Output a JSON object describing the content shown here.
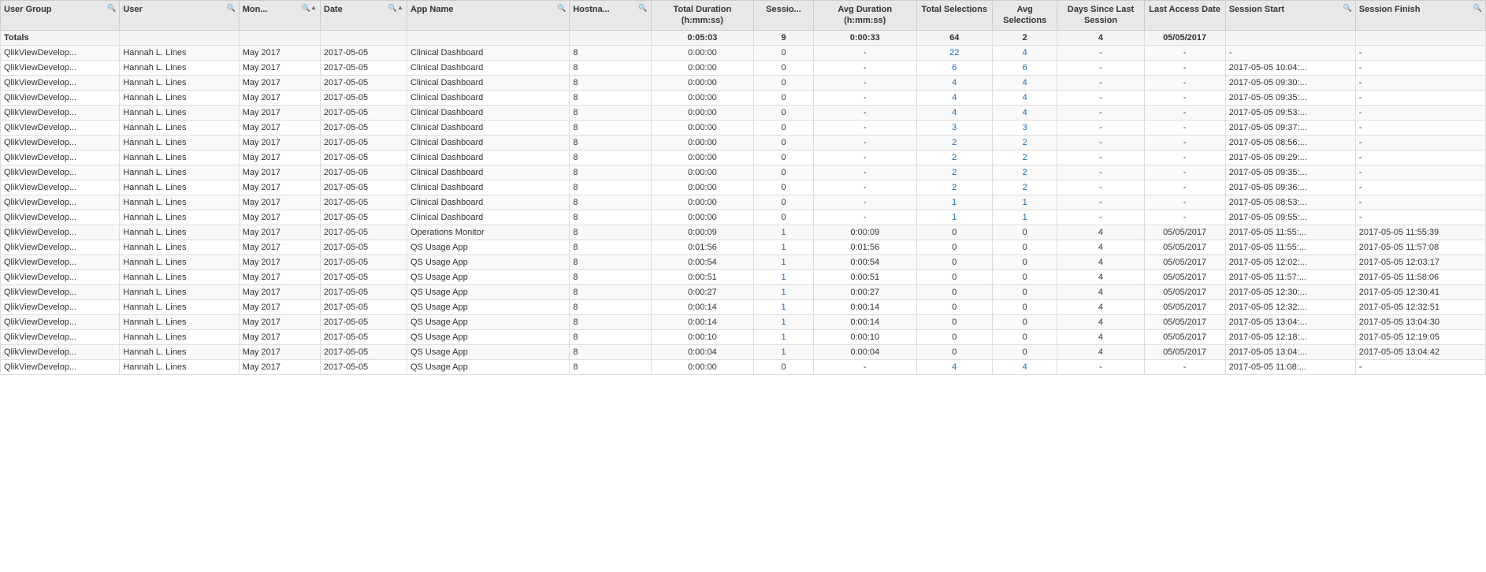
{
  "table": {
    "columns": [
      {
        "key": "usergroup",
        "label": "User Group",
        "searchable": true,
        "class": "col-usergroup"
      },
      {
        "key": "user",
        "label": "User",
        "searchable": true,
        "class": "col-user"
      },
      {
        "key": "month",
        "label": "Mon...",
        "searchable": true,
        "class": "col-month",
        "sortable": true
      },
      {
        "key": "date",
        "label": "Date",
        "searchable": true,
        "class": "col-date",
        "sortable": true
      },
      {
        "key": "appname",
        "label": "App Name",
        "searchable": true,
        "class": "col-appname"
      },
      {
        "key": "hostname",
        "label": "Hostna...",
        "searchable": true,
        "class": "col-hostname"
      },
      {
        "key": "totalduration",
        "label": "Total Duration (h:mm:ss)",
        "searchable": false,
        "class": "col-totalduration"
      },
      {
        "key": "sessions",
        "label": "Sessio...",
        "searchable": false,
        "class": "col-sessions"
      },
      {
        "key": "avgduration",
        "label": "Avg Duration (h:mm:ss)",
        "searchable": false,
        "class": "col-avgduration"
      },
      {
        "key": "totalselections",
        "label": "Total Selections",
        "searchable": false,
        "class": "col-totalselections"
      },
      {
        "key": "avgselections",
        "label": "Avg Selections",
        "searchable": false,
        "class": "col-avgselections"
      },
      {
        "key": "dayssince",
        "label": "Days Since Last Session",
        "searchable": false,
        "class": "col-dayssince"
      },
      {
        "key": "lastaccessdate",
        "label": "Last Access Date",
        "searchable": false,
        "class": "col-lastaccessdate"
      },
      {
        "key": "sessionstart",
        "label": "Session Start",
        "searchable": true,
        "class": "col-sessionstart"
      },
      {
        "key": "sessionfinish",
        "label": "Session Finish",
        "searchable": true,
        "class": "col-sessionfinish"
      }
    ],
    "totals": {
      "totalduration": "0:05:03",
      "sessions": "9",
      "avgduration": "0:00:33",
      "totalselections": "64",
      "avgselections": "2",
      "dayssince": "4",
      "lastaccessdate": "05/05/2017"
    },
    "rows": [
      {
        "usergroup": "QlikViewDevelop...",
        "user": "Hannah L. Lines",
        "month": "May 2017",
        "date": "2017-05-05",
        "appname": "Clinical Dashboard",
        "hostname": "8",
        "totalduration": "0:00:00",
        "sessions": "0",
        "avgduration": "-",
        "totalselections": "22",
        "avgselections": "4",
        "dayssince": "-",
        "lastaccessdate": "-",
        "sessionstart": "-",
        "sessionfinish": "-"
      },
      {
        "usergroup": "QlikViewDevelop...",
        "user": "Hannah L. Lines",
        "month": "May 2017",
        "date": "2017-05-05",
        "appname": "Clinical Dashboard",
        "hostname": "8",
        "totalduration": "0:00:00",
        "sessions": "0",
        "avgduration": "-",
        "totalselections": "6",
        "avgselections": "6",
        "dayssince": "-",
        "lastaccessdate": "-",
        "sessionstart": "2017-05-05 10:04:...",
        "sessionfinish": "-"
      },
      {
        "usergroup": "QlikViewDevelop...",
        "user": "Hannah L. Lines",
        "month": "May 2017",
        "date": "2017-05-05",
        "appname": "Clinical Dashboard",
        "hostname": "8",
        "totalduration": "0:00:00",
        "sessions": "0",
        "avgduration": "-",
        "totalselections": "4",
        "avgselections": "4",
        "dayssince": "-",
        "lastaccessdate": "-",
        "sessionstart": "2017-05-05 09:30:...",
        "sessionfinish": "-"
      },
      {
        "usergroup": "QlikViewDevelop...",
        "user": "Hannah L. Lines",
        "month": "May 2017",
        "date": "2017-05-05",
        "appname": "Clinical Dashboard",
        "hostname": "8",
        "totalduration": "0:00:00",
        "sessions": "0",
        "avgduration": "-",
        "totalselections": "4",
        "avgselections": "4",
        "dayssince": "-",
        "lastaccessdate": "-",
        "sessionstart": "2017-05-05 09:35:...",
        "sessionfinish": "-"
      },
      {
        "usergroup": "QlikViewDevelop...",
        "user": "Hannah L. Lines",
        "month": "May 2017",
        "date": "2017-05-05",
        "appname": "Clinical Dashboard",
        "hostname": "8",
        "totalduration": "0:00:00",
        "sessions": "0",
        "avgduration": "-",
        "totalselections": "4",
        "avgselections": "4",
        "dayssince": "-",
        "lastaccessdate": "-",
        "sessionstart": "2017-05-05 09:53:...",
        "sessionfinish": "-"
      },
      {
        "usergroup": "QlikViewDevelop...",
        "user": "Hannah L. Lines",
        "month": "May 2017",
        "date": "2017-05-05",
        "appname": "Clinical Dashboard",
        "hostname": "8",
        "totalduration": "0:00:00",
        "sessions": "0",
        "avgduration": "-",
        "totalselections": "3",
        "avgselections": "3",
        "dayssince": "-",
        "lastaccessdate": "-",
        "sessionstart": "2017-05-05 09:37:...",
        "sessionfinish": "-"
      },
      {
        "usergroup": "QlikViewDevelop...",
        "user": "Hannah L. Lines",
        "month": "May 2017",
        "date": "2017-05-05",
        "appname": "Clinical Dashboard",
        "hostname": "8",
        "totalduration": "0:00:00",
        "sessions": "0",
        "avgduration": "-",
        "totalselections": "2",
        "avgselections": "2",
        "dayssince": "-",
        "lastaccessdate": "-",
        "sessionstart": "2017-05-05 08:56:...",
        "sessionfinish": "-"
      },
      {
        "usergroup": "QlikViewDevelop...",
        "user": "Hannah L. Lines",
        "month": "May 2017",
        "date": "2017-05-05",
        "appname": "Clinical Dashboard",
        "hostname": "8",
        "totalduration": "0:00:00",
        "sessions": "0",
        "avgduration": "-",
        "totalselections": "2",
        "avgselections": "2",
        "dayssince": "-",
        "lastaccessdate": "-",
        "sessionstart": "2017-05-05 09:29:...",
        "sessionfinish": "-"
      },
      {
        "usergroup": "QlikViewDevelop...",
        "user": "Hannah L. Lines",
        "month": "May 2017",
        "date": "2017-05-05",
        "appname": "Clinical Dashboard",
        "hostname": "8",
        "totalduration": "0:00:00",
        "sessions": "0",
        "avgduration": "-",
        "totalselections": "2",
        "avgselections": "2",
        "dayssince": "-",
        "lastaccessdate": "-",
        "sessionstart": "2017-05-05 09:35:...",
        "sessionfinish": "-"
      },
      {
        "usergroup": "QlikViewDevelop...",
        "user": "Hannah L. Lines",
        "month": "May 2017",
        "date": "2017-05-05",
        "appname": "Clinical Dashboard",
        "hostname": "8",
        "totalduration": "0:00:00",
        "sessions": "0",
        "avgduration": "-",
        "totalselections": "2",
        "avgselections": "2",
        "dayssince": "-",
        "lastaccessdate": "-",
        "sessionstart": "2017-05-05 09:36:...",
        "sessionfinish": "-"
      },
      {
        "usergroup": "QlikViewDevelop...",
        "user": "Hannah L. Lines",
        "month": "May 2017",
        "date": "2017-05-05",
        "appname": "Clinical Dashboard",
        "hostname": "8",
        "totalduration": "0:00:00",
        "sessions": "0",
        "avgduration": "-",
        "totalselections": "1",
        "avgselections": "1",
        "dayssince": "-",
        "lastaccessdate": "-",
        "sessionstart": "2017-05-05 08:53:...",
        "sessionfinish": "-"
      },
      {
        "usergroup": "QlikViewDevelop...",
        "user": "Hannah L. Lines",
        "month": "May 2017",
        "date": "2017-05-05",
        "appname": "Clinical Dashboard",
        "hostname": "8",
        "totalduration": "0:00:00",
        "sessions": "0",
        "avgduration": "-",
        "totalselections": "1",
        "avgselections": "1",
        "dayssince": "-",
        "lastaccessdate": "-",
        "sessionstart": "2017-05-05 09:55:...",
        "sessionfinish": "-"
      },
      {
        "usergroup": "QlikViewDevelop...",
        "user": "Hannah L. Lines",
        "month": "May 2017",
        "date": "2017-05-05",
        "appname": "Operations Monitor",
        "hostname": "8",
        "totalduration": "0:00:09",
        "sessions": "1",
        "avgduration": "0:00:09",
        "totalselections": "0",
        "avgselections": "0",
        "dayssince": "4",
        "lastaccessdate": "05/05/2017",
        "sessionstart": "2017-05-05 11:55:...",
        "sessionfinish": "2017-05-05 11:55:39"
      },
      {
        "usergroup": "QlikViewDevelop...",
        "user": "Hannah L. Lines",
        "month": "May 2017",
        "date": "2017-05-05",
        "appname": "QS Usage App",
        "hostname": "8",
        "totalduration": "0:01:56",
        "sessions": "1",
        "avgduration": "0:01:56",
        "totalselections": "0",
        "avgselections": "0",
        "dayssince": "4",
        "lastaccessdate": "05/05/2017",
        "sessionstart": "2017-05-05 11:55:...",
        "sessionfinish": "2017-05-05 11:57:08"
      },
      {
        "usergroup": "QlikViewDevelop...",
        "user": "Hannah L. Lines",
        "month": "May 2017",
        "date": "2017-05-05",
        "appname": "QS Usage App",
        "hostname": "8",
        "totalduration": "0:00:54",
        "sessions": "1",
        "avgduration": "0:00:54",
        "totalselections": "0",
        "avgselections": "0",
        "dayssince": "4",
        "lastaccessdate": "05/05/2017",
        "sessionstart": "2017-05-05 12:02:...",
        "sessionfinish": "2017-05-05 12:03:17"
      },
      {
        "usergroup": "QlikViewDevelop...",
        "user": "Hannah L. Lines",
        "month": "May 2017",
        "date": "2017-05-05",
        "appname": "QS Usage App",
        "hostname": "8",
        "totalduration": "0:00:51",
        "sessions": "1",
        "avgduration": "0:00:51",
        "totalselections": "0",
        "avgselections": "0",
        "dayssince": "4",
        "lastaccessdate": "05/05/2017",
        "sessionstart": "2017-05-05 11:57:...",
        "sessionfinish": "2017-05-05 11:58:06"
      },
      {
        "usergroup": "QlikViewDevelop...",
        "user": "Hannah L. Lines",
        "month": "May 2017",
        "date": "2017-05-05",
        "appname": "QS Usage App",
        "hostname": "8",
        "totalduration": "0:00:27",
        "sessions": "1",
        "avgduration": "0:00:27",
        "totalselections": "0",
        "avgselections": "0",
        "dayssince": "4",
        "lastaccessdate": "05/05/2017",
        "sessionstart": "2017-05-05 12:30:...",
        "sessionfinish": "2017-05-05 12:30:41"
      },
      {
        "usergroup": "QlikViewDevelop...",
        "user": "Hannah L. Lines",
        "month": "May 2017",
        "date": "2017-05-05",
        "appname": "QS Usage App",
        "hostname": "8",
        "totalduration": "0:00:14",
        "sessions": "1",
        "avgduration": "0:00:14",
        "totalselections": "0",
        "avgselections": "0",
        "dayssince": "4",
        "lastaccessdate": "05/05/2017",
        "sessionstart": "2017-05-05 12:32:...",
        "sessionfinish": "2017-05-05 12:32:51"
      },
      {
        "usergroup": "QlikViewDevelop...",
        "user": "Hannah L. Lines",
        "month": "May 2017",
        "date": "2017-05-05",
        "appname": "QS Usage App",
        "hostname": "8",
        "totalduration": "0:00:14",
        "sessions": "1",
        "avgduration": "0:00:14",
        "totalselections": "0",
        "avgselections": "0",
        "dayssince": "4",
        "lastaccessdate": "05/05/2017",
        "sessionstart": "2017-05-05 13:04:...",
        "sessionfinish": "2017-05-05 13:04:30"
      },
      {
        "usergroup": "QlikViewDevelop...",
        "user": "Hannah L. Lines",
        "month": "May 2017",
        "date": "2017-05-05",
        "appname": "QS Usage App",
        "hostname": "8",
        "totalduration": "0:00:10",
        "sessions": "1",
        "avgduration": "0:00:10",
        "totalselections": "0",
        "avgselections": "0",
        "dayssince": "4",
        "lastaccessdate": "05/05/2017",
        "sessionstart": "2017-05-05 12:18:...",
        "sessionfinish": "2017-05-05 12:19:05"
      },
      {
        "usergroup": "QlikViewDevelop...",
        "user": "Hannah L. Lines",
        "month": "May 2017",
        "date": "2017-05-05",
        "appname": "QS Usage App",
        "hostname": "8",
        "totalduration": "0:00:04",
        "sessions": "1",
        "avgduration": "0:00:04",
        "totalselections": "0",
        "avgselections": "0",
        "dayssince": "4",
        "lastaccessdate": "05/05/2017",
        "sessionstart": "2017-05-05 13:04:...",
        "sessionfinish": "2017-05-05 13:04:42"
      },
      {
        "usergroup": "QlikViewDevelop...",
        "user": "Hannah L. Lines",
        "month": "May 2017",
        "date": "2017-05-05",
        "appname": "QS Usage App",
        "hostname": "8",
        "totalduration": "0:00:00",
        "sessions": "0",
        "avgduration": "-",
        "totalselections": "4",
        "avgselections": "4",
        "dayssince": "-",
        "lastaccessdate": "-",
        "sessionstart": "2017-05-05 11:08:...",
        "sessionfinish": "-"
      }
    ]
  }
}
